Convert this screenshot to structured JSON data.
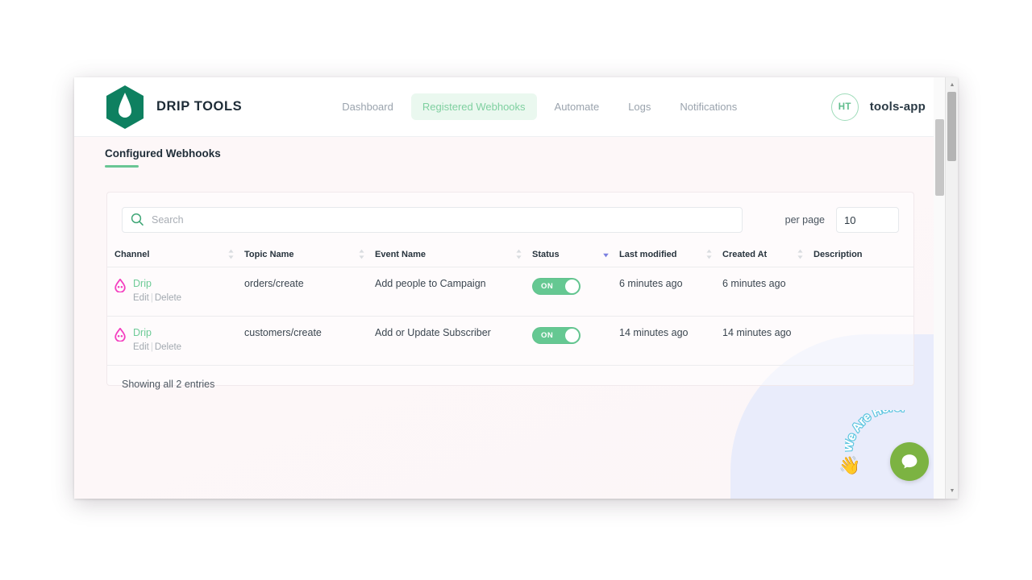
{
  "app": {
    "brand_name": "DRIP TOOLS",
    "logo_icon": "drip-hexagon-logo"
  },
  "nav": {
    "items": [
      {
        "label": "Dashboard",
        "active": false
      },
      {
        "label": "Registered Webhooks",
        "active": true
      },
      {
        "label": "Automate",
        "active": false
      },
      {
        "label": "Logs",
        "active": false
      },
      {
        "label": "Notifications",
        "active": false
      }
    ]
  },
  "user": {
    "initials": "HT",
    "name": "tools-app"
  },
  "section": {
    "tab_label": "Configured Webhooks"
  },
  "search": {
    "placeholder": "Search",
    "value": "",
    "icon": "search-icon"
  },
  "per_page": {
    "label": "per page",
    "value": "10"
  },
  "table": {
    "columns": [
      {
        "label": "Channel",
        "sortable": true,
        "sort": "none"
      },
      {
        "label": "Topic Name",
        "sortable": true,
        "sort": "none"
      },
      {
        "label": "Event Name",
        "sortable": true,
        "sort": "none"
      },
      {
        "label": "Status",
        "sortable": true,
        "sort": "desc"
      },
      {
        "label": "Last modified",
        "sortable": true,
        "sort": "none"
      },
      {
        "label": "Created At",
        "sortable": true,
        "sort": "none"
      },
      {
        "label": "Description",
        "sortable": false,
        "sort": "none"
      }
    ],
    "rows": [
      {
        "channel": "Drip",
        "channel_icon": "drip-droplet-icon",
        "edit_label": "Edit",
        "delete_label": "Delete",
        "topic_name": "orders/create",
        "event_name": "Add people to Campaign",
        "status": "ON",
        "status_on": true,
        "last_modified": "6 minutes ago",
        "created_at": "6 minutes ago",
        "description": ""
      },
      {
        "channel": "Drip",
        "channel_icon": "drip-droplet-icon",
        "edit_label": "Edit",
        "delete_label": "Delete",
        "topic_name": "customers/create",
        "event_name": "Add or Update Subscriber",
        "status": "ON",
        "status_on": true,
        "last_modified": "14 minutes ago",
        "created_at": "14 minutes ago",
        "description": ""
      }
    ],
    "footnote": "Showing all 2 entries"
  },
  "chat_widget": {
    "text": "We Are Here!",
    "hand_icon": "waving-hand-icon",
    "bubble_icon": "chat-bubble-icon"
  },
  "colors": {
    "brand_green": "#0e8060",
    "accent_green": "#65c892",
    "nav_active_bg": "#eaf8ef",
    "drip_pink": "#f43fc0",
    "sort_active": "#7b7fe0",
    "chat_green": "#7cb342",
    "blob_lavender": "#e9ecfb"
  }
}
